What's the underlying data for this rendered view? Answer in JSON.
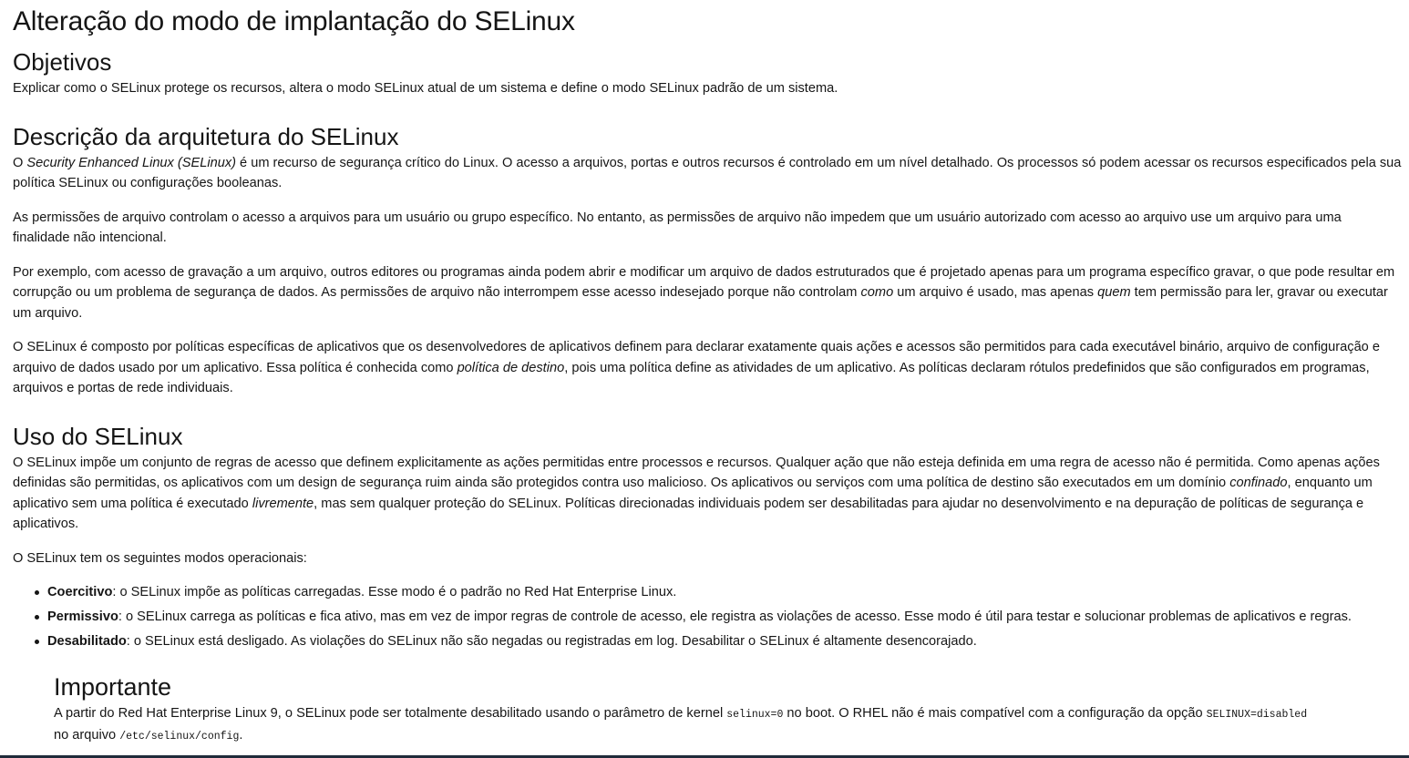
{
  "title": "Alteração do modo de implantação do SELinux",
  "objectives": {
    "heading": "Objetivos",
    "text": "Explicar como o SELinux protege os recursos, altera o modo SELinux atual de um sistema e define o modo SELinux padrão de um sistema."
  },
  "architecture": {
    "heading": "Descrição da arquitetura do SELinux",
    "p1": {
      "pre": "O ",
      "em": "Security Enhanced Linux (SELinux)",
      "post": " é um recurso de segurança crítico do Linux. O acesso a arquivos, portas e outros recursos é controlado em um nível detalhado. Os processos só podem acessar os recursos especificados pela sua política SELinux ou configurações booleanas."
    },
    "p2": "As permissões de arquivo controlam o acesso a arquivos para um usuário ou grupo específico. No entanto, as permissões de arquivo não impedem que um usuário autorizado com acesso ao arquivo use um arquivo para uma finalidade não intencional.",
    "p3": {
      "pre": "Por exemplo, com acesso de gravação a um arquivo, outros editores ou programas ainda podem abrir e modificar um arquivo de dados estruturados que é projetado apenas para um programa específico gravar, o que pode resultar em corrupção ou um problema de segurança de dados. As permissões de arquivo não interrompem esse acesso indesejado porque não controlam ",
      "em1": "como",
      "mid": " um arquivo é usado, mas apenas ",
      "em2": "quem",
      "post": " tem permissão para ler, gravar ou executar um arquivo."
    },
    "p4": {
      "pre": "O SELinux é composto por políticas específicas de aplicativos que os desenvolvedores de aplicativos definem para declarar exatamente quais ações e acessos são permitidos para cada executável binário, arquivo de configuração e arquivo de dados usado por um aplicativo. Essa política é conhecida como ",
      "em": "política de destino",
      "post": ", pois uma política define as atividades de um aplicativo. As políticas declaram rótulos predefinidos que são configurados em programas, arquivos e portas de rede individuais."
    }
  },
  "usage": {
    "heading": "Uso do SELinux",
    "p1": {
      "pre": "O SELinux impõe um conjunto de regras de acesso que definem explicitamente as ações permitidas entre processos e recursos. Qualquer ação que não esteja definida em uma regra de acesso não é permitida. Como apenas ações definidas são permitidas, os aplicativos com um design de segurança ruim ainda são protegidos contra uso malicioso. Os aplicativos ou serviços com uma política de destino são executados em um domínio ",
      "em1": "confinado",
      "mid": ", enquanto um aplicativo sem uma política é executado ",
      "em2": "livremente",
      "post": ", mas sem qualquer proteção do SELinux. Políticas direcionadas individuais podem ser desabilitadas para ajudar no desenvolvimento e na depuração de políticas de segurança e aplicativos."
    },
    "p2": "O SELinux tem os seguintes modos operacionais:",
    "modes": [
      {
        "term": "Coercitivo",
        "desc": ": o SELinux impõe as políticas carregadas. Esse modo é o padrão no Red Hat Enterprise Linux."
      },
      {
        "term": "Permissivo",
        "desc": ": o SELinux carrega as políticas e fica ativo, mas em vez de impor regras de controle de acesso, ele registra as violações de acesso. Esse modo é útil para testar e solucionar problemas de aplicativos e regras."
      },
      {
        "term": "Desabilitado",
        "desc": ": o SELinux está desligado. As violações do SELinux não são negadas ou registradas em log. Desabilitar o SELinux é altamente desencorajado."
      }
    ]
  },
  "important": {
    "heading": "Importante",
    "t1": "A partir do Red Hat Enterprise Linux 9, o SELinux pode ser totalmente desabilitado usando o parâmetro de kernel ",
    "c1": "selinux=0",
    "t2": " no boot. O RHEL não é mais compatível com a configuração da opção ",
    "c2": "SELINUX=disabled",
    "t3": " no arquivo ",
    "c3": "/etc/selinux/config",
    "t4": "."
  }
}
